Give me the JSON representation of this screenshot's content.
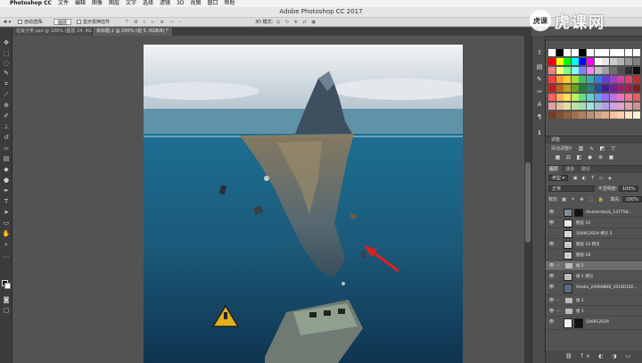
{
  "menubar": {
    "items": [
      "Photoshop CC",
      "文件",
      "编辑",
      "图像",
      "图层",
      "文字",
      "选择",
      "滤镜",
      "3D",
      "视图",
      "窗口",
      "帮助"
    ]
  },
  "window": {
    "title": "Adobe Photoshop CC 2017"
  },
  "options": {
    "auto_select_label": "自动选择:",
    "auto_select_target": "图层",
    "show_transform_label": "显示变换控件",
    "mode_3d_label": "3D 模式:"
  },
  "tabs": [
    {
      "label": "垃圾分类.psd @ 100% (图层 24, RGB/8)"
    },
    {
      "label": "未标题-1 @ 200% (组 5, RGB/8) *"
    }
  ],
  "watermark": {
    "logo_text": "虎课",
    "text": "虎课网"
  },
  "panels": {
    "adjustments": {
      "tab": "调整",
      "add_label": "添加调整"
    },
    "layers": {
      "tabs": [
        "图层",
        "通道",
        "路径"
      ],
      "filter_kind": "类型",
      "blend_mode": "正常",
      "opacity_label": "不透明度:",
      "opacity_value": "100%",
      "lock_label": "锁定:",
      "fill_label": "填充:",
      "fill_value": "100%",
      "items": [
        {
          "name": "shutterstock_147758...",
          "visible": true
        },
        {
          "name": "图层 10",
          "visible": true
        },
        {
          "name": "500912929 拷贝 3",
          "visible": false
        },
        {
          "name": "图层 18 拷贝",
          "visible": true
        },
        {
          "name": "图层 18",
          "visible": false
        },
        {
          "name": "组 5",
          "visible": true
        },
        {
          "name": "组 5 拷贝",
          "visible": true
        },
        {
          "name": "fotolia_24969868_20180102...",
          "visible": true
        },
        {
          "name": "组 2",
          "visible": true
        },
        {
          "name": "组 1",
          "visible": true
        },
        {
          "name": "500912929",
          "visible": true
        }
      ]
    }
  },
  "colors": {
    "accent_arrow": "#e02020",
    "panel_bg": "#535353",
    "layer_selected": "#6e6e6e"
  }
}
